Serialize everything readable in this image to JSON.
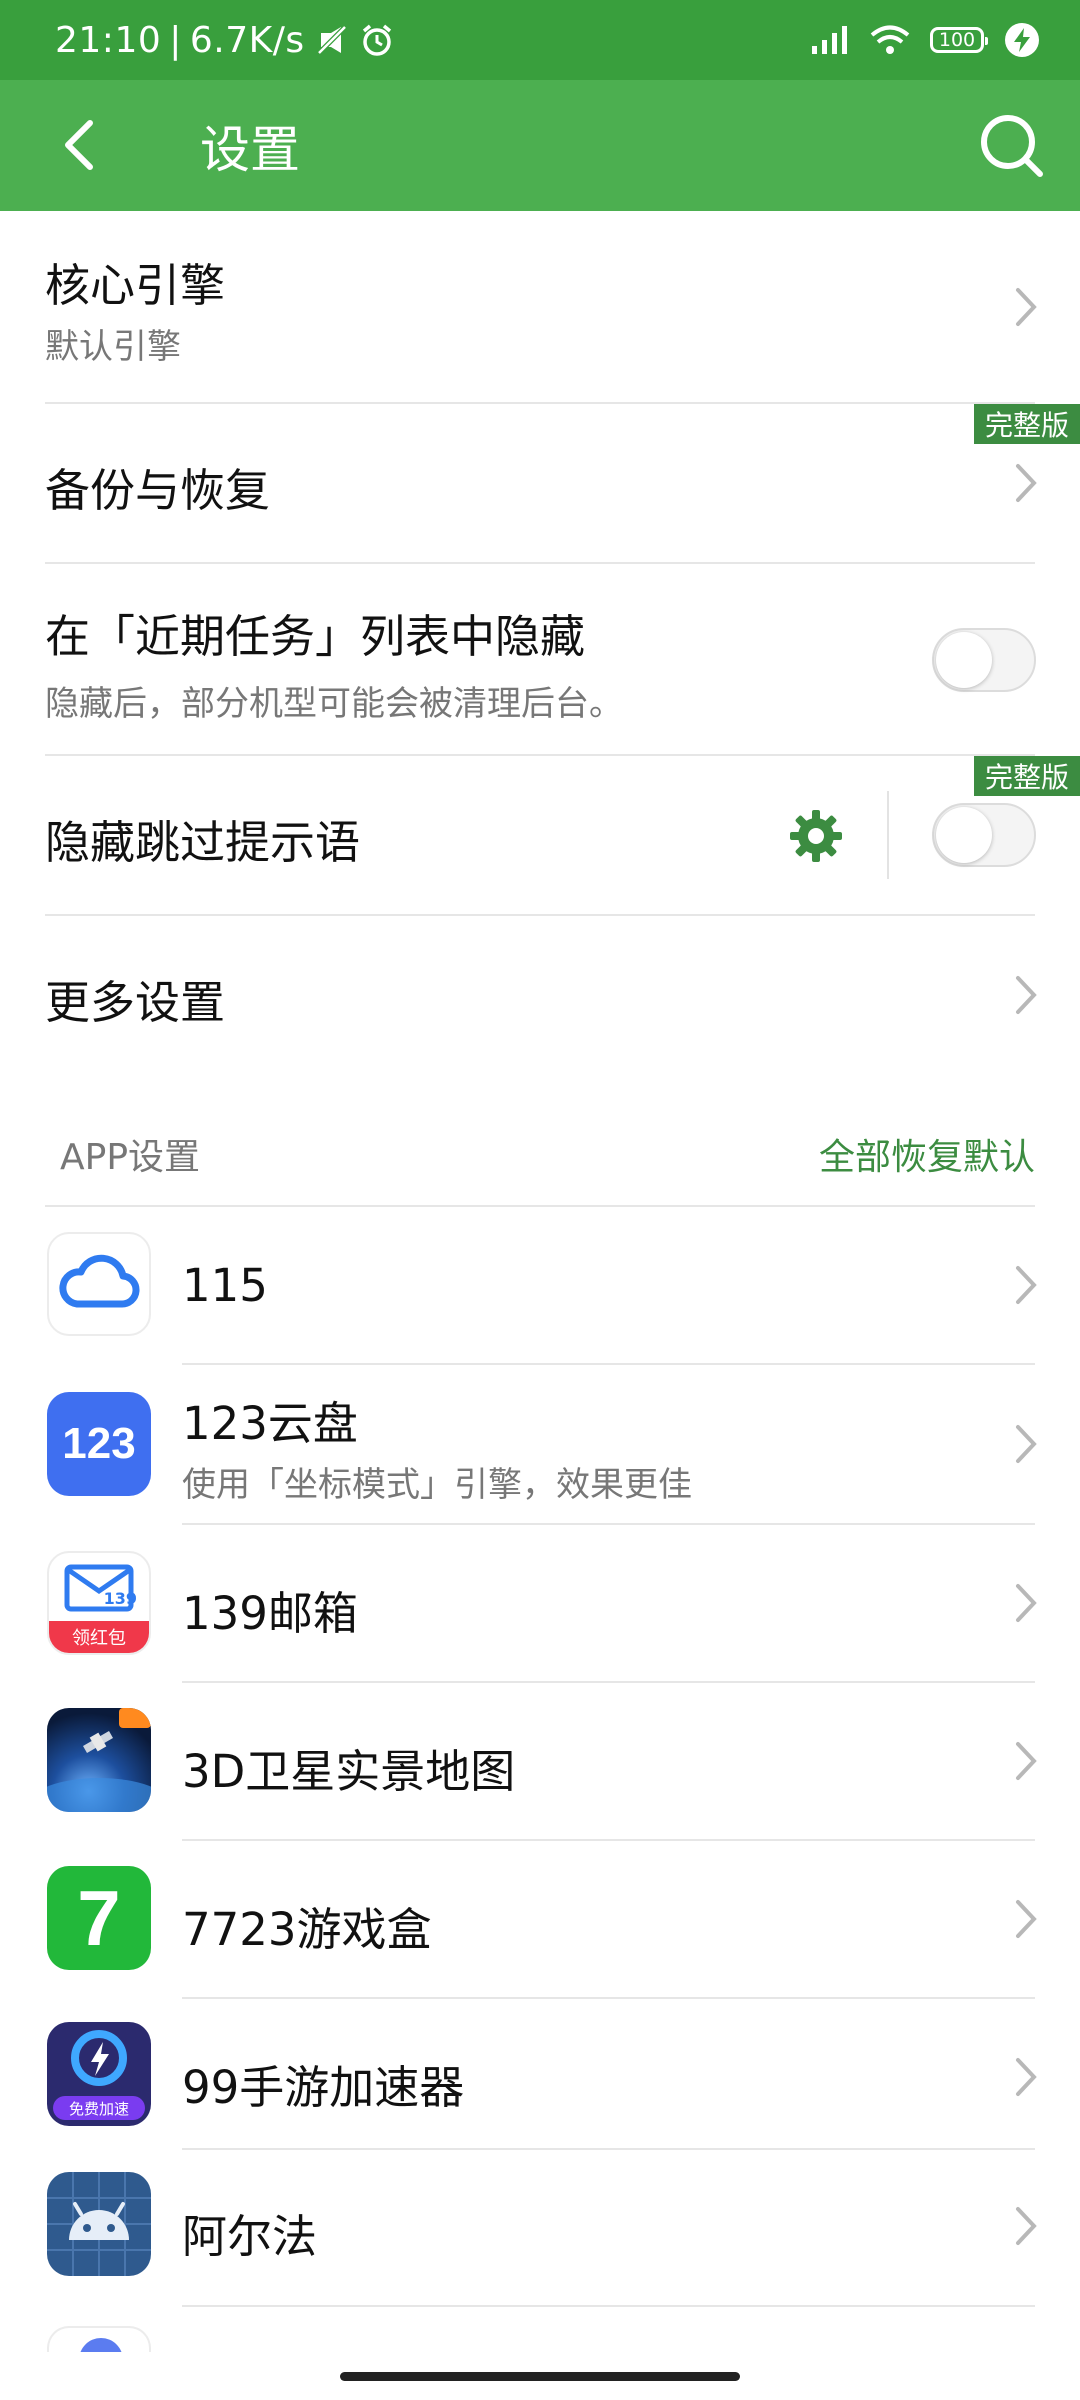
{
  "status_bar": {
    "time": "21:10",
    "net_speed": "6.7K/s",
    "battery": "100",
    "bg_color": "#399f3d"
  },
  "app_bar": {
    "title": "设置",
    "back_icon": "back-arrow-icon",
    "search_icon": "search-icon",
    "bg_color": "#4caf50"
  },
  "settings": {
    "core_engine": {
      "label": "核心引擎",
      "value": "默认引擎"
    },
    "backup": {
      "label": "备份与恢复",
      "badge": "完整版"
    },
    "hide_recents": {
      "label": "在「近期任务」列表中隐藏",
      "description": "隐藏后，部分机型可能会被清理后台。",
      "enabled": false
    },
    "hide_skip_hint": {
      "label": "隐藏跳过提示语",
      "badge": "完整版",
      "enabled": false
    },
    "more_settings": {
      "label": "更多设置"
    }
  },
  "app_section": {
    "header": "APP设置",
    "restore_all": "全部恢复默认",
    "accent_color": "#3c8c41",
    "apps": [
      {
        "name": "115",
        "icon": "cloud-icon"
      },
      {
        "name": "123云盘",
        "subtitle": "使用「坐标模式」引擎，效果更佳",
        "icon": "123-cloud-icon",
        "icon_text": "123"
      },
      {
        "name": "139邮箱",
        "icon": "mail-icon",
        "icon_text": "139",
        "icon_badge": "领红包"
      },
      {
        "name": "3D卫星实景地图",
        "icon": "satellite-icon"
      },
      {
        "name": "7723游戏盒",
        "icon": "game-box-icon",
        "icon_text": "7"
      },
      {
        "name": "99手游加速器",
        "icon": "accelerator-icon",
        "icon_badge": "免费加速"
      },
      {
        "name": "阿尔法",
        "icon": "android-icon"
      }
    ]
  }
}
